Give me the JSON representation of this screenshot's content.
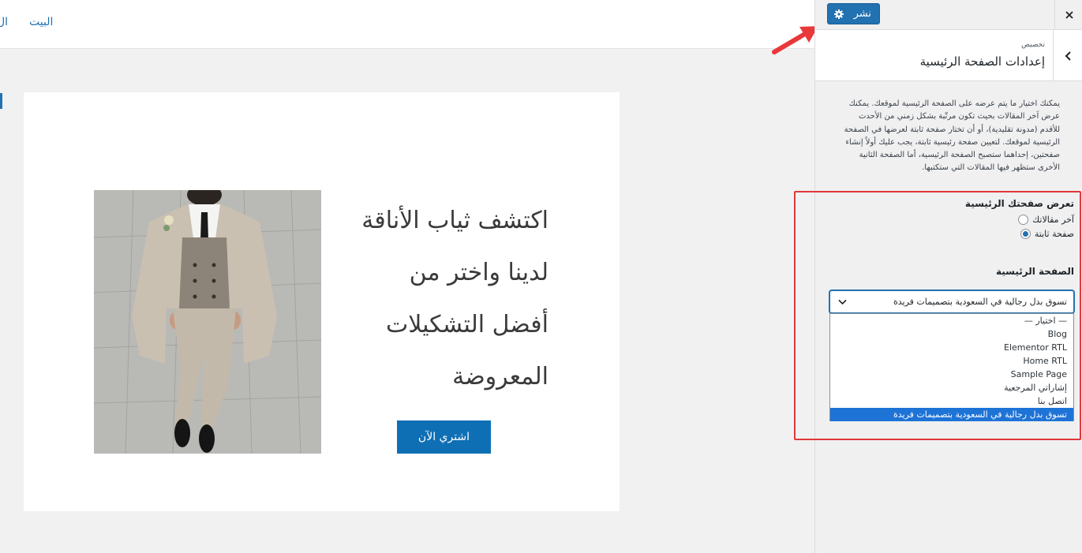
{
  "preview": {
    "nav": {
      "home": "البيت",
      "cut_item": "ال"
    },
    "hero": {
      "heading_lines": [
        "اكتشف ثياب الأناقة",
        "لدينا واختر من",
        "أفضل التشكيلات",
        "المعروضة"
      ],
      "button_label": "اشتري الآن"
    }
  },
  "customizer": {
    "publish_label": "نشر",
    "breadcrumb": "تخصيص",
    "section_title": "إعدادات الصفحة الرئيسية",
    "description": "يمكنك اختيار ما يتم عرضه على الصفحة الرئيسية لموقعك. يمكنك عرض آخر المقالات بحيث تكون مرتّبة بشكل زمني من الأحدث للأقدم (مدونة تقليدية)، أو أن تختار صفحة ثابتة لعرضها في الصفحة الرئيسية لموقعك. لتعيين صفحة رئيسية ثابتة، يجب عليك أولاً إنشاء صفحتين، إحداهما ستصبح الصفحة الرئيسية، أما الصفحة الثانية الأخرى ستظهر فيها المقالات التي ستكتبها.",
    "radio_title": "تعرض صفحتك الرئيسية",
    "radio_options": [
      {
        "label": "آخر مقالاتك",
        "checked": false
      },
      {
        "label": "صفحة ثابتة",
        "checked": true
      }
    ],
    "page_select_label": "الصفحة الرئيسية",
    "page_select_value": "تسوق بدل رجالية في السعودية بتصميمات فريدة",
    "dropdown_options": [
      {
        "label": "— اختيار —",
        "selected": false
      },
      {
        "label": "Blog",
        "selected": false
      },
      {
        "label": "Elementor RTL",
        "selected": false
      },
      {
        "label": "Home RTL",
        "selected": false
      },
      {
        "label": "Sample Page",
        "selected": false
      },
      {
        "label": "إشاراتي المرجعية",
        "selected": false
      },
      {
        "label": "اتصل بنا",
        "selected": false
      },
      {
        "label": "تسوق بدل رجالية في السعودية بتصميمات فريدة",
        "selected": true
      }
    ]
  },
  "colors": {
    "accent": "#2271b1",
    "hero_button": "#0f6fb4",
    "highlight": "#e0383b",
    "selected_option": "#1e73d6"
  },
  "icons": [
    "close-icon",
    "gear-icon",
    "chevron-left-icon",
    "chevron-down-icon",
    "arrow-icon"
  ]
}
